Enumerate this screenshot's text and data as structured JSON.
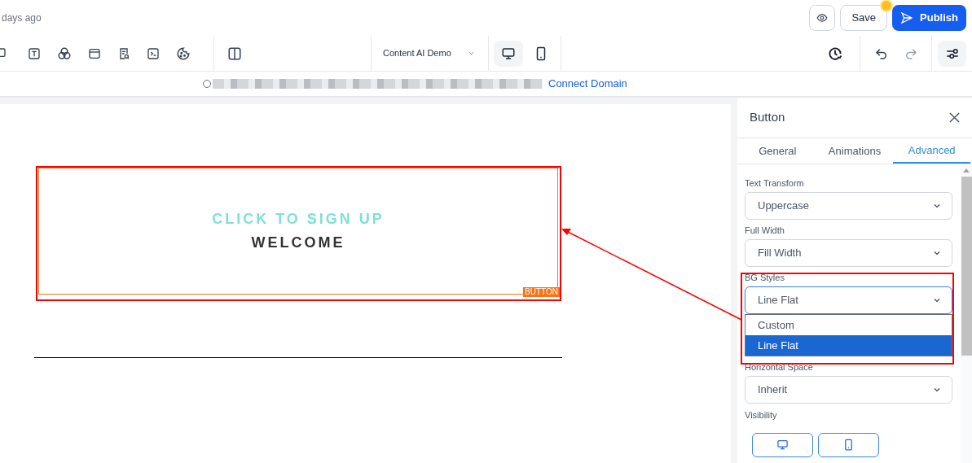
{
  "header": {
    "last_saved": "days ago",
    "save": "Save",
    "unsaved": true,
    "publish": "Publish"
  },
  "toolbar": {
    "page_select": "Content AI Demo",
    "devices": [
      {
        "kind": "desktop",
        "selected": true
      },
      {
        "kind": "mobile",
        "selected": false
      }
    ]
  },
  "url_bar": {
    "connect_link": "Connect Domain"
  },
  "canvas": {
    "heading": "CLICK TO SIGN UP",
    "subheading": "WELCOME",
    "element_tag": "BUTTON"
  },
  "panel": {
    "title": "Button",
    "tabs": [
      {
        "label": "General",
        "selected": false
      },
      {
        "label": "Animations",
        "selected": false
      },
      {
        "label": "Advanced",
        "selected": true
      }
    ],
    "fields": [
      {
        "label": "Text Transform",
        "value": "Uppercase",
        "expanded": false
      },
      {
        "label": "Full Width",
        "value": "Fill Width",
        "expanded": false
      },
      {
        "label": "BG Styles",
        "value": "Line Flat",
        "expanded": true,
        "options": [
          {
            "label": "Custom",
            "selected": false
          },
          {
            "label": "Line Flat",
            "selected": true
          }
        ]
      },
      {
        "label": "Horizontal Space",
        "value": "Inherit",
        "expanded": false
      }
    ],
    "visibility_label": "Visibility",
    "visibility": [
      {
        "kind": "desktop",
        "on": true
      },
      {
        "kind": "mobile",
        "on": true
      }
    ]
  }
}
